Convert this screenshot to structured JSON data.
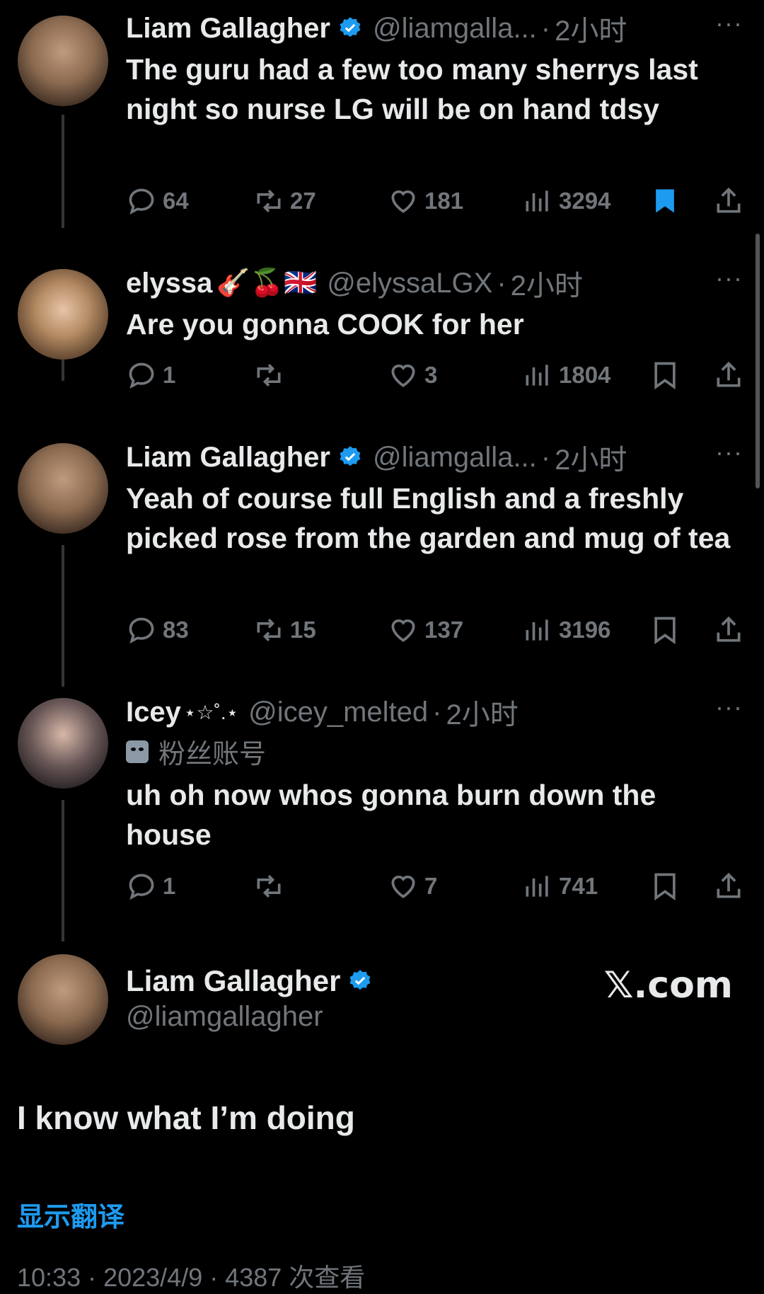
{
  "tweets": [
    {
      "name": "Liam Gallagher",
      "handle": "@liamgalla...",
      "time": "2小时",
      "text": "The guru had a few too many sherrys last night so nurse LG will be on hand tdsy",
      "replies": "64",
      "retweets": "27",
      "likes": "181",
      "views": "3294",
      "bookmarked": true
    },
    {
      "name": "elyssa",
      "emojis": "🎸🍒🇬🇧",
      "handle": "@elyssaLGX",
      "time": "2小时",
      "text": "Are you gonna COOK for her",
      "replies": "1",
      "retweets": "",
      "likes": "3",
      "views": "1804",
      "bookmarked": false
    },
    {
      "name": "Liam Gallagher",
      "handle": "@liamgalla...",
      "time": "2小时",
      "text": "Yeah of course full English and a freshly picked rose from the garden and mug of tea",
      "replies": "83",
      "retweets": "15",
      "likes": "137",
      "views": "3196",
      "bookmarked": false
    },
    {
      "name": "Icey",
      "name_deco": "⋆☆˚.⋆",
      "handle": "@icey_melted",
      "time": "2小时",
      "fan_label": "粉丝账号",
      "text": "uh oh now whos gonna burn down the house",
      "replies": "1",
      "retweets": "",
      "likes": "7",
      "views": "741",
      "bookmarked": false
    }
  ],
  "main_post": {
    "name": "Liam Gallagher",
    "handle": "@liamgallagher",
    "text": "I know what I’m doing",
    "translate": "显示翻译",
    "meta": "10:33 · 2023/4/9 · 4387 次查看"
  },
  "watermark": "𝕏.com",
  "more": "···",
  "dot": "·",
  "colors": {
    "accent": "#1d9bf0",
    "muted": "#71767b",
    "bg": "#000000"
  }
}
